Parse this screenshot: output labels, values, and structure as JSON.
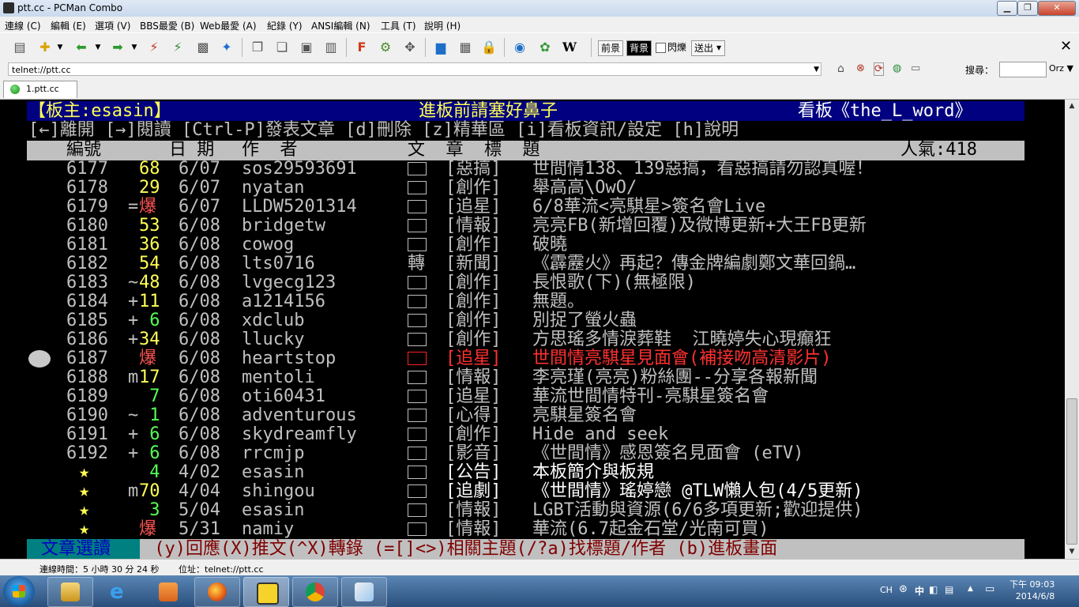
{
  "window": {
    "title": "ptt.cc - PCMan Combo"
  },
  "menu": [
    "連線 (C)",
    "編輯 (E)",
    "選項 (V)",
    "BBS最愛 (B)",
    "Web最愛 (A)",
    "紀錄 (Y)",
    "ANSI編輯 (N)",
    "工具 (T)",
    "說明 (H)"
  ],
  "toolbar": {
    "front_label": "前景",
    "back_label": "背景",
    "blink_label": "閃爍",
    "send_label": "送出",
    "w_label": "W"
  },
  "address": {
    "value": "telnet://ptt.cc",
    "search_label": "搜尋：",
    "orz_label": "Orz"
  },
  "tab": {
    "label": "1.ptt.cc"
  },
  "terminal": {
    "header": {
      "left": "【板主:esasin】",
      "center": "進板前請塞好鼻子",
      "right": "看板《the_L_word》"
    },
    "help_line": "[←]離開 [→]閱讀 [Ctrl-P]發表文章 [d]刪除 [z]精華區 [i]看板資訊/設定 [h]說明",
    "columns": {
      "num": "編號",
      "date": "日 期",
      "author": "作  者",
      "title": "文  章  標  題",
      "popularity": "人氣:418"
    },
    "rows": [
      {
        "num": "6177",
        "mark": " ",
        "score": "68",
        "score_color": "#ffff55",
        "date": "6/07",
        "author": "sos29593691",
        "box": "□",
        "tag": "[惡搞]",
        "title": "世間情138、139惡搞，看惡搞請勿認真喔！",
        "color": "#c0c0c0"
      },
      {
        "num": "6178",
        "mark": " ",
        "score": "29",
        "score_color": "#ffff55",
        "date": "6/07",
        "author": "nyatan",
        "box": "□",
        "tag": "[創作]",
        "title": "舉高高\\OwO/",
        "color": "#c0c0c0"
      },
      {
        "num": "6179",
        "mark": "=",
        "score": "爆",
        "score_color": "#ff5555",
        "date": "6/07",
        "author": "LLDW5201314",
        "box": "□",
        "tag": "[追星]",
        "title": "6/8華流<亮騏星>簽名會Live",
        "color": "#c0c0c0"
      },
      {
        "num": "6180",
        "mark": " ",
        "score": "53",
        "score_color": "#ffff55",
        "date": "6/08",
        "author": "bridgetw",
        "box": "□",
        "tag": "[情報]",
        "title": "亮亮FB(新增回覆)及微博更新+大王FB更新",
        "color": "#c0c0c0"
      },
      {
        "num": "6181",
        "mark": " ",
        "score": "36",
        "score_color": "#ffff55",
        "date": "6/08",
        "author": "cowog",
        "box": "□",
        "tag": "[創作]",
        "title": "破曉",
        "color": "#c0c0c0"
      },
      {
        "num": "6182",
        "mark": " ",
        "score": "54",
        "score_color": "#ffff55",
        "date": "6/08",
        "author": "lts0716",
        "box": "轉",
        "tag": "[新聞]",
        "title": "《霹靂火》再起？傳金牌編劇鄭文華回鍋…",
        "color": "#c0c0c0"
      },
      {
        "num": "6183",
        "mark": "~",
        "score": "48",
        "score_color": "#ffff55",
        "date": "6/08",
        "author": "lvgecg123",
        "box": "□",
        "tag": "[創作]",
        "title": "長恨歌(下)(無極限)",
        "color": "#c0c0c0"
      },
      {
        "num": "6184",
        "mark": "+",
        "score": "11",
        "score_color": "#ffff55",
        "date": "6/08",
        "author": "a1214156",
        "box": "□",
        "tag": "[創作]",
        "title": "無題。",
        "color": "#c0c0c0"
      },
      {
        "num": "6185",
        "mark": "+",
        "score": " 6",
        "score_color": "#55ff55",
        "date": "6/08",
        "author": "xdclub",
        "box": "□",
        "tag": "[創作]",
        "title": "別捉了螢火蟲",
        "color": "#c0c0c0"
      },
      {
        "num": "6186",
        "mark": "+",
        "score": "34",
        "score_color": "#ffff55",
        "date": "6/08",
        "author": "llucky",
        "box": "□",
        "tag": "[創作]",
        "title": "方思瑤多情淚葬鞋  江曉婷失心現癲狂",
        "color": "#c0c0c0"
      },
      {
        "num": "6187",
        "mark": " ",
        "score": "爆",
        "score_color": "#ff5555",
        "date": "6/08",
        "author": "heartstop",
        "box": "□",
        "tag": "[追星]",
        "title": "世間情亮騏星見面會(補接吻高清影片)",
        "color": "#ff3030",
        "selected": true
      },
      {
        "num": "6188",
        "mark": "m",
        "score": "17",
        "score_color": "#ffff55",
        "date": "6/08",
        "author": "mentoli",
        "box": "□",
        "tag": "[情報]",
        "title": "李亮瑾(亮亮)粉絲團--分享各報新聞",
        "color": "#c0c0c0"
      },
      {
        "num": "6189",
        "mark": " ",
        "score": " 7",
        "score_color": "#55ff55",
        "date": "6/08",
        "author": "oti60431",
        "box": "□",
        "tag": "[追星]",
        "title": "華流世間情特刊-亮騏星簽名會",
        "color": "#c0c0c0"
      },
      {
        "num": "6190",
        "mark": "~",
        "score": " 1",
        "score_color": "#55ff55",
        "date": "6/08",
        "author": "adventurous",
        "box": "□",
        "tag": "[心得]",
        "title": "亮騏星簽名會",
        "color": "#c0c0c0"
      },
      {
        "num": "6191",
        "mark": "+",
        "score": " 6",
        "score_color": "#55ff55",
        "date": "6/08",
        "author": "skydreamfly",
        "box": "□",
        "tag": "[創作]",
        "title": "Hide and seek",
        "color": "#c0c0c0"
      },
      {
        "num": "6192",
        "mark": "+",
        "score": " 6",
        "score_color": "#55ff55",
        "date": "6/08",
        "author": "rrcmjp",
        "box": "□",
        "tag": "[影音]",
        "title": "《世間情》感恩簽名見面會 (eTV)",
        "color": "#c0c0c0"
      },
      {
        "num": "★",
        "mark": " ",
        "score": " 4",
        "score_color": "#55ff55",
        "date": "4/02",
        "author": "esasin",
        "box": "□",
        "tag": "[公告]",
        "title": "本板簡介與板規",
        "color": "#ffffff"
      },
      {
        "num": "★",
        "mark": "m",
        "score": "70",
        "score_color": "#ffff55",
        "date": "4/04",
        "author": "shingou",
        "box": "□",
        "tag": "[追劇]",
        "title": "《世間情》瑤婷戀 @TLW懶人包(4/5更新)",
        "color": "#ffffff"
      },
      {
        "num": "★",
        "mark": " ",
        "score": " 3",
        "score_color": "#55ff55",
        "date": "5/04",
        "author": "esasin",
        "box": "□",
        "tag": "[情報]",
        "title": "LGBT活動與資源(6/6多項更新;歡迎提供)",
        "color": "#c0c0c0"
      },
      {
        "num": "★",
        "mark": " ",
        "score": "爆",
        "score_color": "#ff5555",
        "date": "5/31",
        "author": "namiy",
        "box": "□",
        "tag": "[情報]",
        "title": "華流(6.7起金石堂/光南可買)",
        "color": "#c0c0c0"
      }
    ],
    "footer": {
      "mode": "文章選讀",
      "help": " (y)回應(X)推文(^X)轉錄 (=[]<>)相關主題(/?a)找標題/作者 (b)進板畫面"
    }
  },
  "status": {
    "connect_time": "連線時間：5 小時 30 分 24 秒",
    "location": "位址：telnet://ptt.cc"
  },
  "tray": {
    "lang": "CH",
    "ime": "中",
    "time": "下午 09:03",
    "date": "2014/6/8"
  }
}
